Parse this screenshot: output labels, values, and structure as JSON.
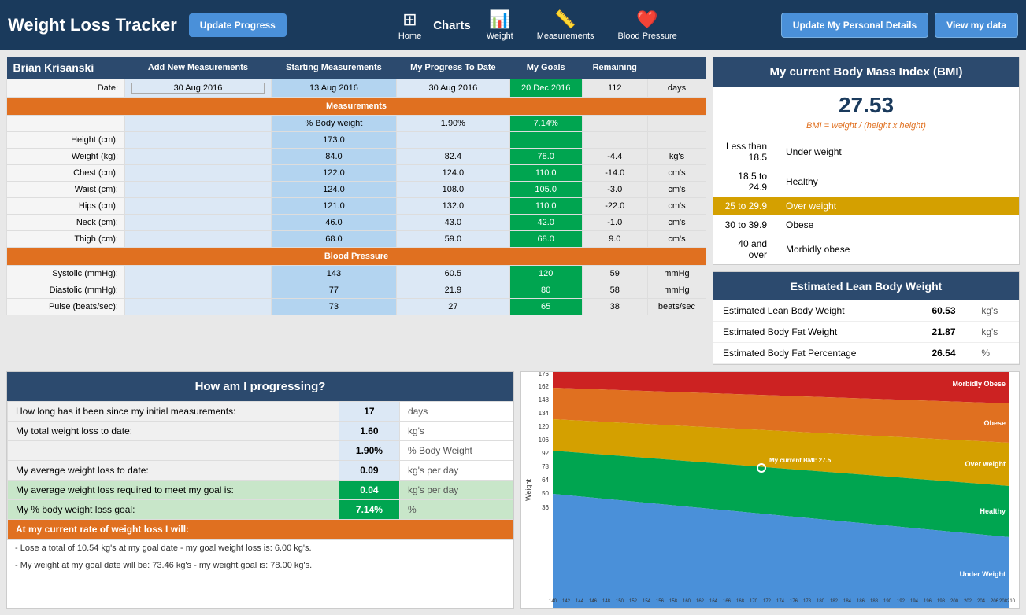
{
  "header": {
    "title": "Weight Loss Tracker",
    "update_progress_btn": "Update Progress",
    "home_label": "Home",
    "charts_label": "Charts",
    "weight_label": "Weight",
    "measurements_label": "Measurements",
    "blood_pressure_label": "Blood Pressure",
    "update_personal_btn": "Update My Personal Details",
    "view_data_btn": "View my data"
  },
  "user": {
    "name": "Brian Krisanski"
  },
  "table": {
    "col_add_new": "Add New Measurements",
    "col_starting": "Starting Measurements",
    "col_progress": "My Progress To Date",
    "col_goals": "My Goals",
    "col_remaining": "Remaining",
    "date_label": "Date:",
    "date_add": "30 Aug 2016",
    "date_start": "13 Aug 2016",
    "date_progress": "30 Aug 2016",
    "date_goal": "20 Dec 2016",
    "remaining_days": "112",
    "remaining_days_unit": "days",
    "measurements_label": "Measurements",
    "pct_body_weight": "% Body weight",
    "pct_progress": "1.90%",
    "pct_goal": "7.14%",
    "rows": [
      {
        "label": "Height (cm):",
        "start": "173.0",
        "progress": "",
        "goal": "",
        "remaining": "",
        "unit": ""
      },
      {
        "label": "Weight (kg):",
        "start": "84.0",
        "progress": "82.4",
        "goal": "78.0",
        "remaining": "-4.4",
        "unit": "kg's"
      },
      {
        "label": "Chest (cm):",
        "start": "122.0",
        "progress": "124.0",
        "goal": "110.0",
        "remaining": "-14.0",
        "unit": "cm's"
      },
      {
        "label": "Waist (cm):",
        "start": "124.0",
        "progress": "108.0",
        "goal": "105.0",
        "remaining": "-3.0",
        "unit": "cm's"
      },
      {
        "label": "Hips (cm):",
        "start": "121.0",
        "progress": "132.0",
        "goal": "110.0",
        "remaining": "-22.0",
        "unit": "cm's"
      },
      {
        "label": "Neck (cm):",
        "start": "46.0",
        "progress": "43.0",
        "goal": "42.0",
        "remaining": "-1.0",
        "unit": "cm's"
      },
      {
        "label": "Thigh (cm):",
        "start": "68.0",
        "progress": "59.0",
        "goal": "68.0",
        "remaining": "9.0",
        "unit": "cm's"
      }
    ],
    "bp_label": "Blood Pressure",
    "bp_rows": [
      {
        "label": "Systolic (mmHg):",
        "start": "143",
        "progress": "60.5",
        "goal": "120",
        "remaining": "59",
        "unit": "mmHg"
      },
      {
        "label": "Diastolic (mmHg):",
        "start": "77",
        "progress": "21.9",
        "goal": "80",
        "remaining": "58",
        "unit": "mmHg"
      },
      {
        "label": "Pulse (beats/sec):",
        "start": "73",
        "progress": "27",
        "goal": "65",
        "remaining": "38",
        "unit": "beats/sec"
      }
    ]
  },
  "bmi": {
    "title": "My current Body Mass Index (BMI)",
    "value": "27.53",
    "formula": "BMI = weight / (height x height)",
    "categories": [
      {
        "range": "Less than 18.5",
        "label": "Under weight",
        "highlight": false
      },
      {
        "range": "18.5 to 24.9",
        "label": "Healthy",
        "highlight": false
      },
      {
        "range": "25 to 29.9",
        "label": "Over weight",
        "highlight": true
      },
      {
        "range": "30 to 39.9",
        "label": "Obese",
        "highlight": false
      },
      {
        "range": "40 and over",
        "label": "Morbidly obese",
        "highlight": false
      }
    ]
  },
  "lean": {
    "title": "Estimated Lean Body Weight",
    "rows": [
      {
        "label": "Estimated Lean Body Weight",
        "value": "60.53",
        "unit": "kg's"
      },
      {
        "label": "Estimated Body Fat Weight",
        "value": "21.87",
        "unit": "kg's"
      },
      {
        "label": "Estimated Body Fat Percentage",
        "value": "26.54",
        "unit": "%"
      }
    ]
  },
  "progress": {
    "title": "How am I progressing?",
    "rows": [
      {
        "label": "How long has it been since my initial measurements:",
        "value": "17",
        "unit": "days"
      },
      {
        "label": "My total weight loss to date:",
        "value": "1.60",
        "unit": "kg's"
      },
      {
        "label": "",
        "value": "1.90%",
        "unit": "% Body Weight"
      },
      {
        "label": "My average weight loss to date:",
        "value": "0.09",
        "unit": "kg's per day"
      },
      {
        "label": "My average weight loss required to meet my goal is:",
        "value": "0.04",
        "unit": "kg's per day",
        "highlight": "green"
      },
      {
        "label": "My % body weight loss goal:",
        "value": "7.14%",
        "unit": "%",
        "highlight": "green"
      },
      {
        "label": "At my current rate of weight loss I will:",
        "orange": true
      }
    ],
    "note1": " - Lose a total of 10.54 kg's at my goal date - my goal weight loss is: 6.00 kg's.",
    "note2": " - My weight at my goal date will be: 73.46 kg's - my weight goal is: 78.00 kg's."
  },
  "chart": {
    "y_axis_labels": [
      176,
      162,
      148,
      134,
      120,
      106,
      92,
      78,
      64,
      50,
      36
    ],
    "x_axis_labels": [
      140,
      142,
      144,
      146,
      148,
      150,
      152,
      154,
      156,
      158,
      160,
      162,
      164,
      166,
      168,
      170,
      172,
      174,
      176,
      178,
      180,
      182,
      184,
      186,
      188,
      190,
      192,
      194,
      196,
      198,
      200,
      202,
      204,
      206,
      208,
      210
    ],
    "y_label": "Weight",
    "bmi_label": "My current BMI: 27.5",
    "zones": [
      {
        "label": "Morbidly Obese",
        "color": "#cc2222"
      },
      {
        "label": "Obese",
        "color": "#e07020"
      },
      {
        "label": "Over weight",
        "color": "#d4a000"
      },
      {
        "label": "Healthy",
        "color": "#00a550"
      },
      {
        "label": "Under Weight",
        "color": "#4a90d9"
      }
    ]
  }
}
